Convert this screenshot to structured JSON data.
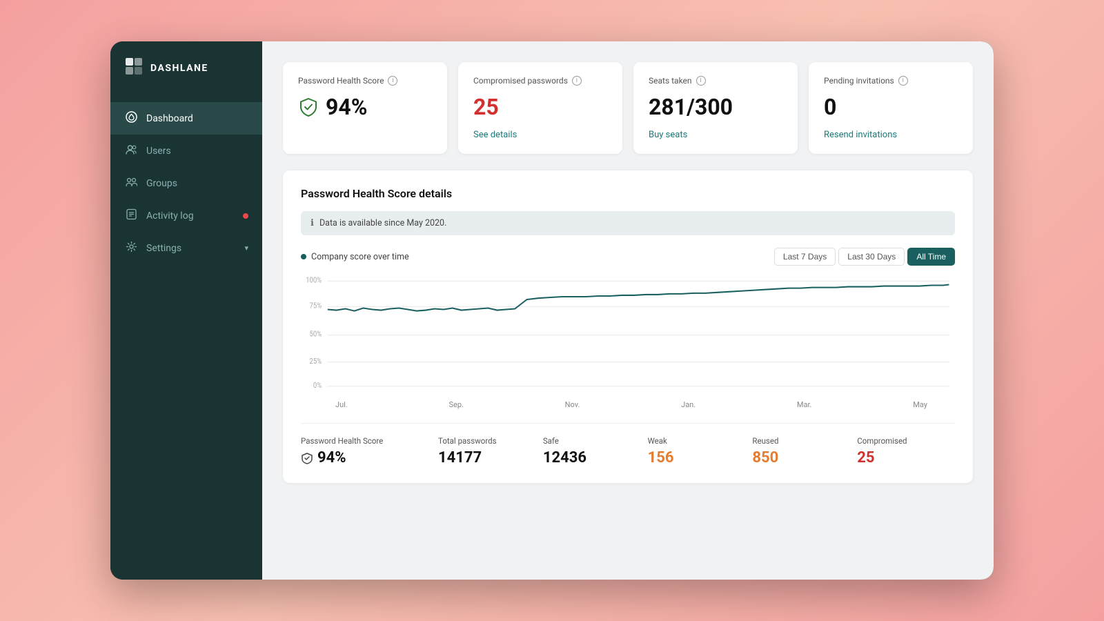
{
  "app": {
    "name": "DASHLANE"
  },
  "sidebar": {
    "items": [
      {
        "id": "dashboard",
        "label": "Dashboard",
        "icon": "dashboard",
        "active": true,
        "badge": false
      },
      {
        "id": "users",
        "label": "Users",
        "icon": "users",
        "active": false,
        "badge": false
      },
      {
        "id": "groups",
        "label": "Groups",
        "icon": "groups",
        "active": false,
        "badge": false
      },
      {
        "id": "activity-log",
        "label": "Activity log",
        "icon": "activity",
        "active": false,
        "badge": true
      },
      {
        "id": "settings",
        "label": "Settings",
        "icon": "settings",
        "active": false,
        "badge": false,
        "chevron": true
      }
    ]
  },
  "stats": {
    "health_score": {
      "title": "Password Health Score",
      "value": "94%",
      "link": null
    },
    "compromised": {
      "title": "Compromised passwords",
      "value": "25",
      "link": "See details"
    },
    "seats": {
      "title": "Seats taken",
      "value": "281/300",
      "link": "Buy seats"
    },
    "invitations": {
      "title": "Pending invitations",
      "value": "0",
      "link": "Resend invitations"
    }
  },
  "chart": {
    "title": "Password Health Score details",
    "banner": "Data is available since May 2020.",
    "legend": "Company score over time",
    "time_buttons": [
      "Last 7 Days",
      "Last 30 Days",
      "All Time"
    ],
    "active_time": "All Time",
    "x_labels": [
      "Jul.",
      "Sep.",
      "Nov.",
      "Jan.",
      "Mar.",
      "May"
    ],
    "y_labels": [
      "100%",
      "75%",
      "50%",
      "25%",
      "0%"
    ]
  },
  "summary": {
    "health_score_label": "Password Health Score",
    "health_score_value": "94%",
    "total_passwords_label": "Total passwords",
    "total_passwords_value": "14177",
    "safe_label": "Safe",
    "safe_value": "12436",
    "weak_label": "Weak",
    "weak_value": "156",
    "reused_label": "Reused",
    "reused_value": "850",
    "compromised_label": "Compromised",
    "compromised_value": "25"
  }
}
